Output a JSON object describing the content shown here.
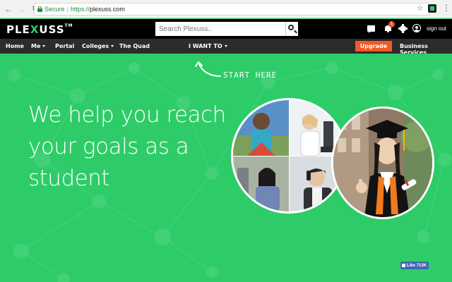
{
  "browser": {
    "secure_label": "Secure",
    "url_scheme": "https://",
    "url_host": "plexuss.com"
  },
  "header": {
    "logo_pre": "PLE",
    "logo_x": "X",
    "logo_post": "USS",
    "logo_tm": "TM",
    "search_placeholder": "Search Plexuss..",
    "notification_count": "1",
    "signout_label": "sign out"
  },
  "nav": {
    "home": "Home",
    "me": "Me",
    "portal": "Portal",
    "colleges": "Colleges",
    "quad": "The Quad",
    "i_want_to": "I WANT TO",
    "upgrade": "Upgrade",
    "business": "Business Services"
  },
  "hero": {
    "start_here": "START HERE",
    "headline_line1": "We help you reach",
    "headline_line2": "your goals as a",
    "headline_line3": "student"
  },
  "social": {
    "like_label": "Like",
    "like_count": "713K"
  },
  "colors": {
    "brand_green": "#2ecc68",
    "upgrade_orange": "#ef5a25",
    "header_black": "#000000",
    "nav_dark": "#2c2c2c",
    "facebook_blue": "#4267b2"
  }
}
